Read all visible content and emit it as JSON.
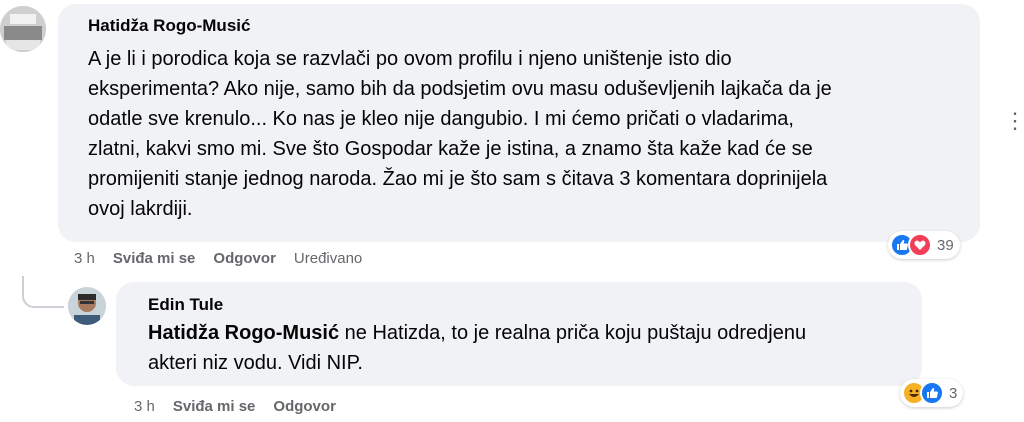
{
  "comment1": {
    "author": "Hatidža Rogo-Musić",
    "lines": [
      "A je li i porodica koja se razvlači po ovom profilu i njeno uništenje isto dio",
      "eksperimenta? Ako nije, samo bih da podsjetim ovu masu oduševljenih lajkača da je",
      "odatle sve krenulo... Ko nas je kleo nije dangubio. I mi ćemo pričati o vladarima,",
      "zlatni, kakvi smo mi. Sve što Gospodar kaže je istina, a znamo šta kaže kad će se",
      "promijeniti stanje jednog naroda. Žao mi je što sam s čitava 3 komentara doprinijela",
      "ovoj lakrdiji."
    ],
    "time": "3 h",
    "like": "Sviđa mi se",
    "reply": "Odgovor",
    "edited": "Uređivano",
    "reaction_count": "39",
    "reaction_icons": [
      "like-icon",
      "love-icon"
    ],
    "more": "⋮"
  },
  "comment2": {
    "author": "Edin Tule",
    "mention": "Hatidža Rogo-Musić",
    "line1_rest": " ne Hatizda, to je realna priča koju puštaju odredjenu",
    "line2": "akteri niz vodu. Vidi NIP.",
    "time": "3 h",
    "like": "Sviđa mi se",
    "reply": "Odgovor",
    "reaction_count": "3",
    "reaction_icons": [
      "haha-icon",
      "like-icon"
    ]
  },
  "colors": {
    "bubble": "#f0f2f5",
    "like_blue": "#1877f2",
    "love_red": "#f33e58",
    "haha_yellow": "#f7b125",
    "meta_gray": "#65676b"
  }
}
